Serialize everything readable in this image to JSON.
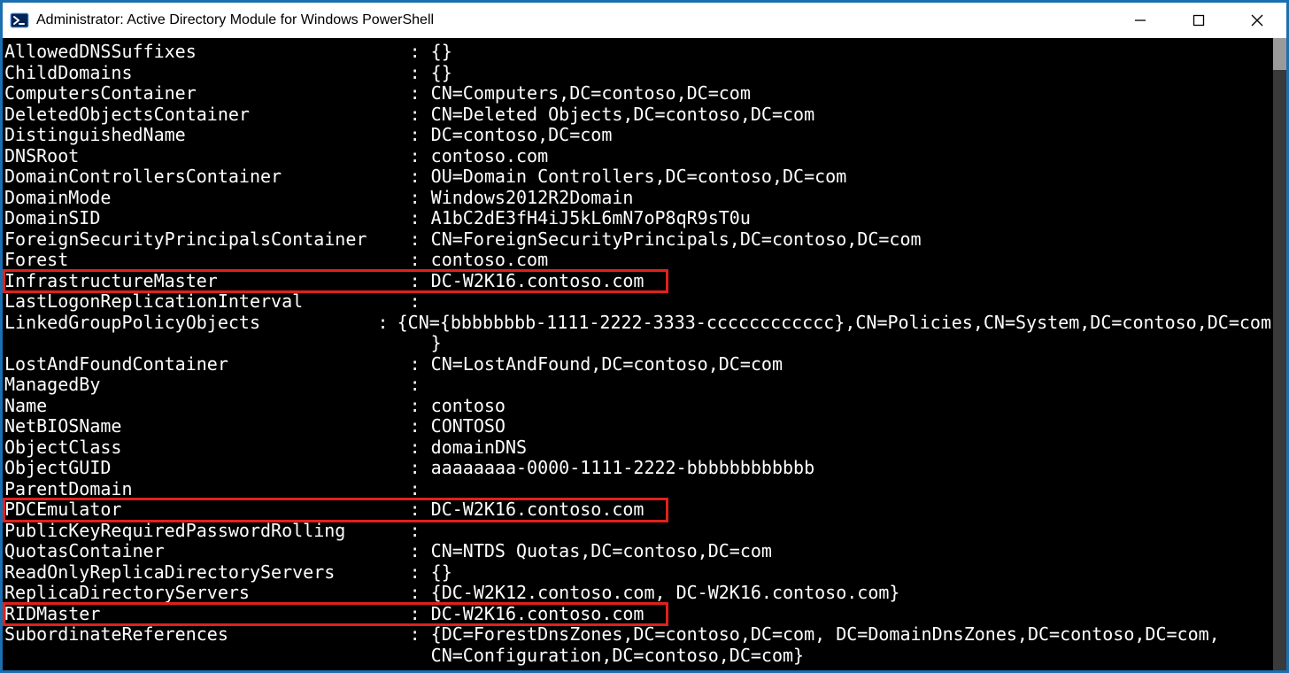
{
  "window": {
    "title": "Administrator: Active Directory Module for Windows PowerShell"
  },
  "console": {
    "key_col_width_chars": 38,
    "lines": [
      {
        "key": "AllowedDNSSuffixes",
        "value": "{}"
      },
      {
        "key": "ChildDomains",
        "value": "{}"
      },
      {
        "key": "ComputersContainer",
        "value": "CN=Computers,DC=contoso,DC=com"
      },
      {
        "key": "DeletedObjectsContainer",
        "value": "CN=Deleted Objects,DC=contoso,DC=com"
      },
      {
        "key": "DistinguishedName",
        "value": "DC=contoso,DC=com"
      },
      {
        "key": "DNSRoot",
        "value": "contoso.com"
      },
      {
        "key": "DomainControllersContainer",
        "value": "OU=Domain Controllers,DC=contoso,DC=com"
      },
      {
        "key": "DomainMode",
        "value": "Windows2012R2Domain"
      },
      {
        "key": "DomainSID",
        "value": "A1bC2dE3fH4iJ5kL6mN7oP8qR9sT0u"
      },
      {
        "key": "ForeignSecurityPrincipalsContainer",
        "value": "CN=ForeignSecurityPrincipals,DC=contoso,DC=com"
      },
      {
        "key": "Forest",
        "value": "contoso.com"
      },
      {
        "key": "InfrastructureMaster",
        "value": "DC-W2K16.contoso.com",
        "highlight": true
      },
      {
        "key": "LastLogonReplicationInterval",
        "value": ""
      },
      {
        "key": "LinkedGroupPolicyObjects",
        "value": "{CN={bbbbbbbb-1111-2222-3333-cccccccccccc},CN=Policies,CN=System,DC=contoso,DC=com",
        "continuation": "}"
      },
      {
        "key": "LostAndFoundContainer",
        "value": "CN=LostAndFound,DC=contoso,DC=com"
      },
      {
        "key": "ManagedBy",
        "value": ""
      },
      {
        "key": "Name",
        "value": "contoso"
      },
      {
        "key": "NetBIOSName",
        "value": "CONTOSO"
      },
      {
        "key": "ObjectClass",
        "value": "domainDNS"
      },
      {
        "key": "ObjectGUID",
        "value": "aaaaaaaa-0000-1111-2222-bbbbbbbbbbbb"
      },
      {
        "key": "ParentDomain",
        "value": ""
      },
      {
        "key": "PDCEmulator",
        "value": "DC-W2K16.contoso.com",
        "highlight": true
      },
      {
        "key": "PublicKeyRequiredPasswordRolling",
        "value": ""
      },
      {
        "key": "QuotasContainer",
        "value": "CN=NTDS Quotas,DC=contoso,DC=com"
      },
      {
        "key": "ReadOnlyReplicaDirectoryServers",
        "value": "{}"
      },
      {
        "key": "ReplicaDirectoryServers",
        "value": "{DC-W2K12.contoso.com, DC-W2K16.contoso.com}"
      },
      {
        "key": "RIDMaster",
        "value": "DC-W2K16.contoso.com",
        "highlight": true
      },
      {
        "key": "SubordinateReferences",
        "value": "{DC=ForestDnsZones,DC=contoso,DC=com, DC=DomainDnsZones,DC=contoso,DC=com,",
        "continuation": "CN=Configuration,DC=contoso,DC=com}"
      }
    ]
  }
}
